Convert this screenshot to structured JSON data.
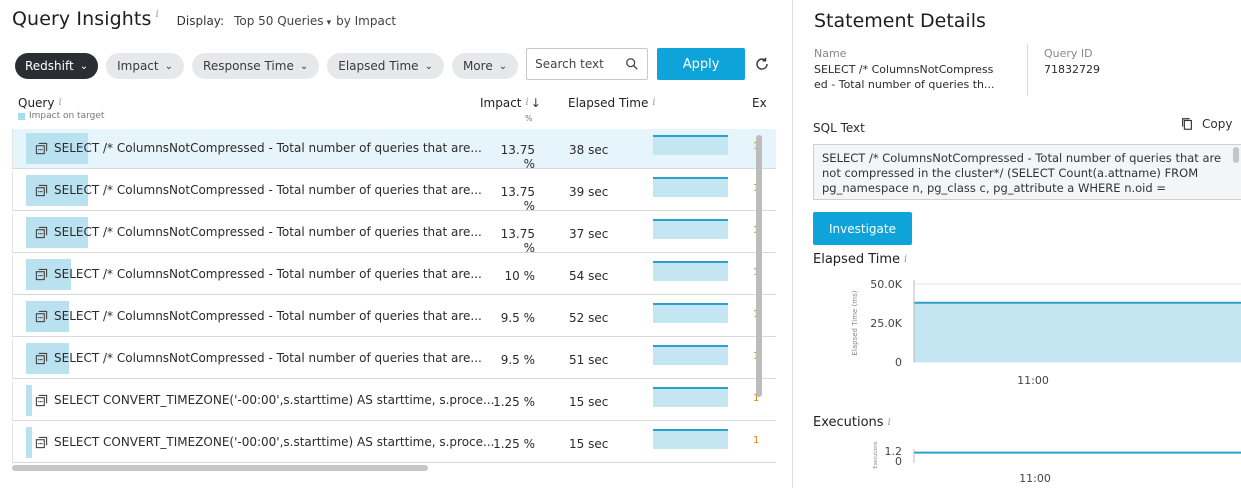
{
  "left": {
    "title": "Query Insights",
    "display_label": "Display:",
    "display_value": "Top 50 Queries",
    "display_by": "by Impact",
    "filters": [
      {
        "label": "Redshift",
        "active": true
      },
      {
        "label": "Impact",
        "active": false
      },
      {
        "label": "Response Time",
        "active": false
      },
      {
        "label": "Elapsed Time",
        "active": false
      },
      {
        "label": "More",
        "active": false
      }
    ],
    "search_placeholder": "Search text",
    "apply_label": "Apply",
    "reset_label": "Re",
    "columns": {
      "query": "Query",
      "query_sub": "Impact on target",
      "impact": "Impact",
      "impact_unit": "%",
      "elapsed": "Elapsed Time",
      "executions": "Ex"
    },
    "rows": [
      {
        "query": "SELECT /* ColumnsNotCompressed - Total number of queries that are...",
        "impact": "13.75 %",
        "elapsed": "38 sec",
        "impact_fraction": 0.1375,
        "exec": "1",
        "selected": true
      },
      {
        "query": "SELECT /* ColumnsNotCompressed - Total number of queries that are...",
        "impact": "13.75 %",
        "elapsed": "39 sec",
        "impact_fraction": 0.1375,
        "exec": "1",
        "selected": false
      },
      {
        "query": "SELECT /* ColumnsNotCompressed - Total number of queries that are...",
        "impact": "13.75 %",
        "elapsed": "37 sec",
        "impact_fraction": 0.1375,
        "exec": "1",
        "selected": false
      },
      {
        "query": "SELECT /* ColumnsNotCompressed - Total number of queries that are...",
        "impact": "10 %",
        "elapsed": "54 sec",
        "impact_fraction": 0.1,
        "exec": "1",
        "selected": false
      },
      {
        "query": "SELECT /* ColumnsNotCompressed - Total number of queries that are...",
        "impact": "9.5 %",
        "elapsed": "52 sec",
        "impact_fraction": 0.095,
        "exec": "1",
        "selected": false
      },
      {
        "query": "SELECT /* ColumnsNotCompressed - Total number of queries that are...",
        "impact": "9.5 %",
        "elapsed": "51 sec",
        "impact_fraction": 0.095,
        "exec": "1",
        "selected": false
      },
      {
        "query": "SELECT CONVERT_TIMEZONE('-00:00',s.starttime) AS starttime, s.proce...",
        "impact": "1.25 %",
        "elapsed": "15 sec",
        "impact_fraction": 0.0125,
        "exec": "1",
        "selected": false
      },
      {
        "query": "SELECT CONVERT_TIMEZONE('-00:00',s.starttime) AS starttime, s.proce...",
        "impact": "1.25 %",
        "elapsed": "15 sec",
        "impact_fraction": 0.0125,
        "exec": "1",
        "selected": false
      }
    ]
  },
  "right": {
    "title": "Statement Details",
    "name_label": "Name",
    "name_line1": "SELECT /* ColumnsNotCompress",
    "name_line2": "ed - Total number of queries th...",
    "query_id_label": "Query ID",
    "query_id": "71832729",
    "sql_label": "SQL Text",
    "copy_label": "Copy",
    "sql_line1": "SELECT /* ColumnsNotCompressed - Total number of queries that are",
    "sql_line2": "not compressed in the cluster*/ (SELECT Count(a.attname) FROM",
    "sql_line3": "pg_namespace n, pg_class c, pg_attribute a WHERE n.oid =",
    "investigate_label": "Investigate",
    "elapsed_title": "Elapsed Time",
    "executions_title": "Executions"
  },
  "chart_data": [
    {
      "type": "area",
      "title": "Elapsed Time",
      "ylabel": "Elapsed Time (ms)",
      "ytick_labels": [
        "50.0K",
        "25.0K",
        "0"
      ],
      "yticks": [
        50000,
        25000,
        0
      ],
      "ylim": [
        0,
        50000
      ],
      "xtick_labels": [
        "11:00"
      ],
      "series": [
        {
          "values": [
            38000,
            38000
          ]
        }
      ],
      "color": "#2aa0cc",
      "fill": "#c4e6f2"
    },
    {
      "type": "line",
      "title": "Executions",
      "ylabel": "Executions",
      "ytick_labels": [
        "1.2",
        "0"
      ],
      "yticks": [
        1.2,
        0
      ],
      "ylim": [
        0,
        1.2
      ],
      "xtick_labels": [
        "11:00"
      ],
      "series": [
        {
          "values": [
            1,
            1
          ]
        }
      ],
      "color": "#2aa0cc"
    }
  ],
  "colors": {
    "accent": "#0ea3d9",
    "bar": "#b9e1f0",
    "selected_row": "#e6f4fb",
    "dark_pill": "#2a2e33"
  },
  "icons": {
    "row": "query-snippet-icon",
    "search": "search-icon",
    "reset": "reset-icon",
    "copy": "copy-icon",
    "info": "info-icon"
  }
}
